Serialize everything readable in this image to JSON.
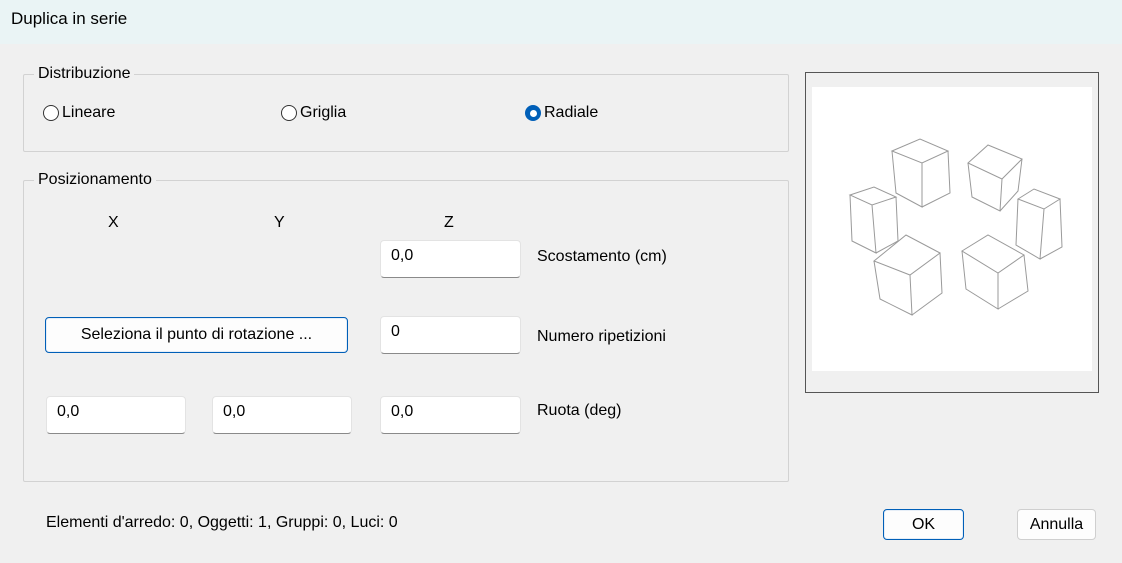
{
  "window": {
    "title": "Duplica in serie"
  },
  "distribution": {
    "legend": "Distribuzione",
    "options": [
      {
        "label": "Lineare",
        "checked": false
      },
      {
        "label": "Griglia",
        "checked": false
      },
      {
        "label": "Radiale",
        "checked": true
      }
    ]
  },
  "positioning": {
    "legend": "Posizionamento",
    "axes": {
      "x": "X",
      "y": "Y",
      "z": "Z"
    },
    "offset": {
      "z_value": "0,0",
      "label": "Scostamento (cm)"
    },
    "rotation_point_button": "Seleziona il punto di rotazione ...",
    "repetitions": {
      "value": "0",
      "label": "Numero ripetizioni"
    },
    "rotate": {
      "x_value": "0,0",
      "y_value": "0,0",
      "z_value": "0,0",
      "label": "Ruota (deg)"
    }
  },
  "status": "Elementi d'arredo: 0, Oggetti: 1, Gruppi: 0, Luci: 0",
  "buttons": {
    "ok": "OK",
    "cancel": "Annulla"
  },
  "colors": {
    "accent": "#005fb8",
    "title_bar": "#eaf4f5",
    "background": "#f0f0f0"
  },
  "preview": {
    "icon": "radial-cubes-preview"
  }
}
